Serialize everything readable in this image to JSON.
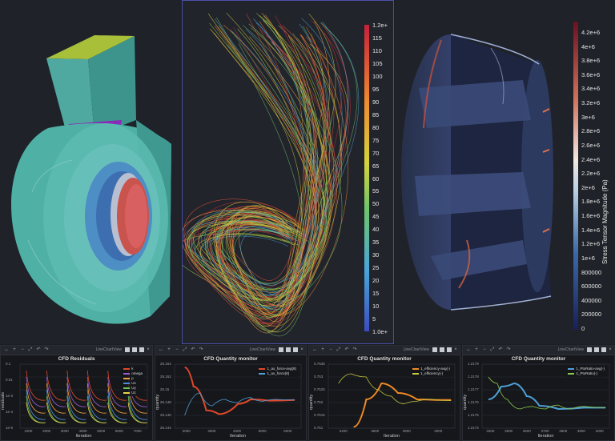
{
  "views": {
    "streamline_colorbar": {
      "labels": [
        "1.2e+",
        "115",
        "110",
        "105",
        "100",
        "95",
        "90",
        "85",
        "80",
        "75",
        "70",
        "65",
        "60",
        "55",
        "50",
        "45",
        "40",
        "35",
        "30",
        "25",
        "20",
        "15",
        "10",
        "5",
        "1.0e+"
      ]
    },
    "stress_colorbar": {
      "title": "Stress Tensor Magnitude (Pa)",
      "labels": [
        "4.2e+6",
        "4e+6",
        "3.8e+6",
        "3.6e+6",
        "3.4e+6",
        "3.2e+6",
        "3e+6",
        "2.8e+6",
        "2.6e+6",
        "2.4e+6",
        "2.2e+6",
        "2e+6",
        "1.8e+6",
        "1.6e+6",
        "1.4e+6",
        "1.2e+6",
        "1e+6",
        "800000",
        "600000",
        "400000",
        "200000",
        "0"
      ]
    }
  },
  "toolbar": {
    "layout_label": "LineChartView"
  },
  "panels": [
    {
      "title": "CFD Residuals",
      "xlabel": "Iteration",
      "ylabel": "residuals",
      "xticks": [
        "1000",
        "2000",
        "3000",
        "4000",
        "5000",
        "6000",
        "7000"
      ],
      "yticks": [
        "0.1",
        "0.01",
        "1e-3",
        "1e-4",
        "1e-5"
      ],
      "legend": [
        {
          "name": "k",
          "color": "#e04a2a"
        },
        {
          "name": "omega",
          "color": "#9b5bd0"
        },
        {
          "name": "p",
          "color": "#f2a23a"
        },
        {
          "name": "Ux",
          "color": "#4f8fd8"
        },
        {
          "name": "Uy",
          "color": "#6cc35a"
        },
        {
          "name": "Uz",
          "color": "#e8d64a"
        }
      ]
    },
    {
      "title": "CFD Quantity monitor",
      "xlabel": "Iteration",
      "ylabel": "quantity",
      "xticks": [
        "2000",
        "3000",
        "4000",
        "5000",
        "6000"
      ],
      "yticks": [
        "25.154",
        "25.152",
        "25.15",
        "25.148",
        "25.146",
        "25.144"
      ],
      "legend": [
        {
          "name": "1_ax_force-avg(8)",
          "color": "#e0482a"
        },
        {
          "name": "1_ax_force(8)",
          "color": "#4f9fd8"
        }
      ]
    },
    {
      "title": "CFD Quantity monitor",
      "xlabel": "Iteration",
      "ylabel": "quantity",
      "xticks": [
        "3400",
        "3600",
        "3800",
        "4000"
      ],
      "yticks": [
        "0.7535",
        "0.753",
        "0.7525",
        "0.752",
        "0.7515",
        "0.751"
      ],
      "legend": [
        {
          "name": "1_efficiency-avg(-)",
          "color": "#f08a24"
        },
        {
          "name": "1_efficiency(-)",
          "color": "#c9c93c"
        }
      ]
    },
    {
      "title": "CFD Quantity monitor",
      "xlabel": "Iteration",
      "ylabel": "quantity",
      "xticks": [
        "3400",
        "3500",
        "3600",
        "3700",
        "3800",
        "3900",
        "4000"
      ],
      "yticks": [
        "1.2179",
        "1.2178",
        "1.2177",
        "1.2176",
        "1.2175",
        "1.2174"
      ],
      "legend": [
        {
          "name": "1_PtoRatio-avg(-)",
          "color": "#4f9fd8"
        },
        {
          "name": "1_PtoRatio(-)",
          "color": "#8ac94a"
        }
      ]
    }
  ]
}
